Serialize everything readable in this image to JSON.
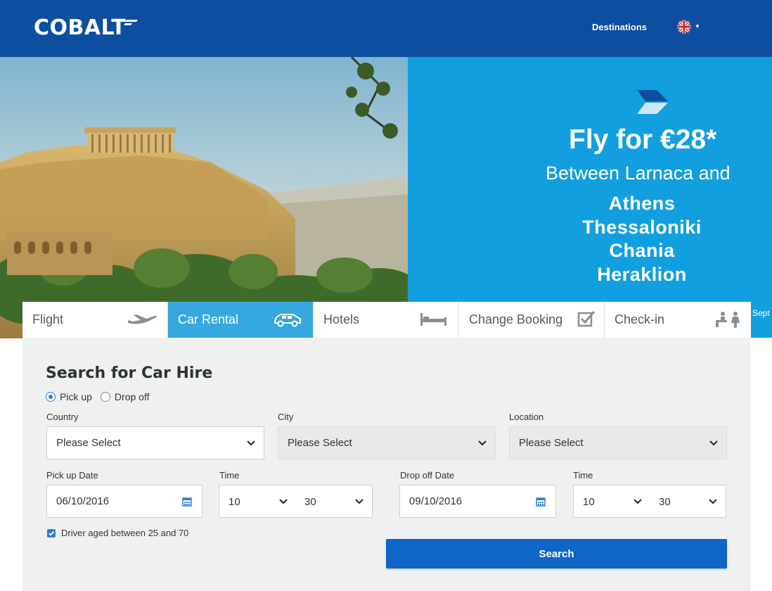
{
  "header": {
    "logo": "COBALT",
    "nav_destinations": "Destinations",
    "language_icon": "uk-flag-icon"
  },
  "hero": {
    "photo_description_icon": "acropolis-photo",
    "promo": {
      "icon": "cobalt-chevron-icon",
      "title": "Fly for €28*",
      "subtitle": "Between Larnaca and",
      "cities": [
        "Athens",
        "Thessaloniki",
        "Chania",
        "Heraklion"
      ]
    },
    "overflow_text": "Sept"
  },
  "tabs": [
    {
      "label": "Flight",
      "icon": "plane-icon"
    },
    {
      "label": "Car Rental",
      "icon": "car-icon"
    },
    {
      "label": "Hotels",
      "icon": "bed-icon"
    },
    {
      "label": "Change Booking",
      "icon": "checkbox-edit-icon"
    },
    {
      "label": "Check-in",
      "icon": "check-in-counter-icon"
    }
  ],
  "search": {
    "title": "Search for Car Hire",
    "radio_pickup": "Pick up",
    "radio_dropoff": "Drop off",
    "country_label": "Country",
    "country_value": "Please Select",
    "city_label": "City",
    "city_value": "Please Select",
    "location_label": "Location",
    "location_value": "Please Select",
    "pickup_date_label": "Pick up Date",
    "pickup_date_value": "06/10/2016",
    "pickup_time_label": "Time",
    "pickup_hour": "10",
    "pickup_minute": "30",
    "dropoff_date_label": "Drop off Date",
    "dropoff_date_value": "09/10/2016",
    "dropoff_time_label": "Time",
    "dropoff_hour": "10",
    "dropoff_minute": "30",
    "driver_age_label": "Driver aged between 25 and 70",
    "search_button": "Search"
  },
  "colors": {
    "header_bg": "#0d4ea1",
    "promo_bg": "#129fe0",
    "active_tab": "#36a8e0",
    "search_button": "#0e66c6",
    "panel_bg": "#eff1f1"
  }
}
